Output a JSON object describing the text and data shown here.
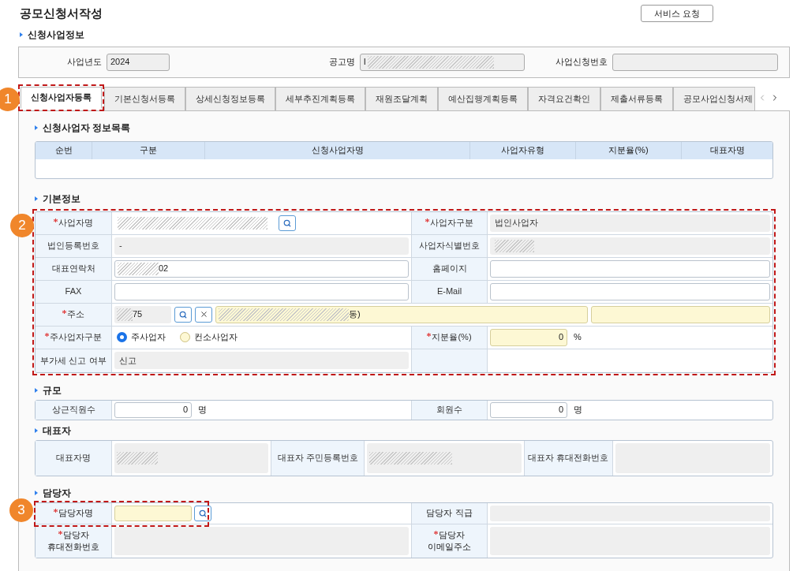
{
  "page_title": "공모신청서작성",
  "service_button": "서비스 요청",
  "info_section": {
    "title": "신청사업정보",
    "fields": [
      {
        "label": "사업년도",
        "value": "2024"
      },
      {
        "label": "공고명",
        "value": "I",
        "redacted": true
      },
      {
        "label": "사업신청번호"
      }
    ]
  },
  "tabs": [
    {
      "label": "신청사업자등록",
      "selected": true,
      "callout": "1"
    },
    {
      "label": "기본신청서등록",
      "selected": false
    },
    {
      "label": "상세신청정보등록",
      "selected": false
    },
    {
      "label": "세부추진계획등록",
      "selected": false
    },
    {
      "label": "재원조달계획",
      "selected": false
    },
    {
      "label": "예산집행계획등록",
      "selected": false
    },
    {
      "label": "자격요건확인",
      "selected": false
    },
    {
      "label": "제출서류등록",
      "selected": false
    },
    {
      "label": "공모사업신청서제",
      "selected": false
    }
  ],
  "applicant_list": {
    "title": "신청사업자 정보목록",
    "columns": [
      "순번",
      "구분",
      "신청사업자명",
      "사업자유형",
      "지분율(%)",
      "대표자명"
    ]
  },
  "basic_info": {
    "title": "기본정보",
    "callout": "2",
    "rows": [
      {
        "cells": [
          {
            "label": "사업자명",
            "required": true,
            "kind": "search",
            "redacted": true
          },
          {
            "label": "사업자구분",
            "required": true,
            "kind": "readonly",
            "value": "법인사업자"
          }
        ]
      },
      {
        "cells": [
          {
            "label": "법인등록번호",
            "kind": "readonly",
            "value": "-"
          },
          {
            "label": "사업자식별번호",
            "kind": "readonly",
            "redacted": true
          }
        ]
      },
      {
        "cells": [
          {
            "label": "대표연락처",
            "kind": "input",
            "value": "02",
            "redacted": true
          },
          {
            "label": "홈페이지",
            "kind": "input"
          }
        ]
      },
      {
        "cells": [
          {
            "label": "FAX",
            "kind": "input"
          },
          {
            "label": "E-Mail",
            "kind": "input"
          }
        ]
      },
      {
        "cells": [
          {
            "label": "주소",
            "required": true,
            "kind": "address",
            "zip": "75",
            "address1": "동)",
            "redacted": true
          }
        ]
      },
      {
        "cells": [
          {
            "label": "주사업자구분",
            "required": true,
            "kind": "radio",
            "options": [
              {
                "label": "주사업자",
                "selected": true
              },
              {
                "label": "컨소사업자",
                "selected": false
              }
            ]
          },
          {
            "label": "지분율(%)",
            "required": true,
            "kind": "number",
            "value": "0",
            "unit": "%",
            "highlighted": true
          }
        ]
      },
      {
        "cells": [
          {
            "label": "부가세 신고 여부",
            "kind": "readonly",
            "value": "신고"
          },
          {
            "kind": "blank"
          }
        ]
      }
    ]
  },
  "scale": {
    "title": "규모",
    "cells": [
      {
        "label": "상근직원수",
        "value": "0",
        "unit": "명"
      },
      {
        "label": "회원수",
        "value": "0",
        "unit": "명"
      }
    ]
  },
  "representative": {
    "title": "대표자",
    "cells": [
      {
        "label": "대표자명",
        "redacted": true
      },
      {
        "label": "대표자 주민등록번호",
        "redacted": true
      },
      {
        "label": "대표자 휴대전화번호"
      }
    ]
  },
  "contact": {
    "title": "담당자",
    "callout": "3",
    "cells": [
      {
        "label_lines": [
          "담당자명"
        ],
        "required": true,
        "kind": "search",
        "highlighted": true
      },
      {
        "label_lines": [
          "담당자 직급"
        ],
        "kind": "readonly"
      },
      {
        "label_lines": [
          "담당자",
          "휴대전화번호"
        ],
        "required": true,
        "kind": "readonly"
      },
      {
        "label_lines": [
          "담당자",
          "이메일주소"
        ],
        "required": true,
        "kind": "readonly"
      }
    ]
  }
}
